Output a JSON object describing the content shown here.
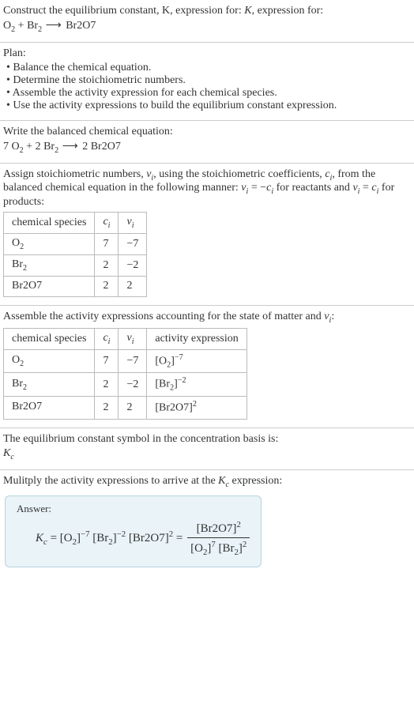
{
  "s1": {
    "prompt": "Construct the equilibrium constant, K, expression for:",
    "eq_lhs1": "O",
    "eq_lhs1_sub": "2",
    "plus1": " + ",
    "eq_lhs2": "Br",
    "eq_lhs2_sub": "2",
    "arrow": " ⟶ ",
    "eq_rhs": "Br2O7"
  },
  "plan": {
    "title": "Plan:",
    "items": [
      "Balance the chemical equation.",
      "Determine the stoichiometric numbers.",
      "Assemble the activity expression for each chemical species.",
      "Use the activity expressions to build the equilibrium constant expression."
    ]
  },
  "s3": {
    "prompt": "Write the balanced chemical equation:",
    "c1": "7 ",
    "sp1a": "O",
    "sp1b": "2",
    "plus": " + 2 ",
    "sp2a": "Br",
    "sp2b": "2",
    "arrow": " ⟶ ",
    "c3": "2 Br2O7"
  },
  "s4": {
    "prompt_a": "Assign stoichiometric numbers, ",
    "nu": "ν",
    "nu_sub": "i",
    "prompt_b": ", using the stoichiometric coefficients, ",
    "c": "c",
    "c_sub": "i",
    "prompt_c": ", from the balanced chemical equation in the following manner: ",
    "rel1a": "ν",
    "rel1b": "i",
    "rel1eq": " = −",
    "rel1c": "c",
    "rel1d": "i",
    "prompt_d": " for reactants and ",
    "rel2a": "ν",
    "rel2b": "i",
    "rel2eq": " = ",
    "rel2c": "c",
    "rel2d": "i",
    "prompt_e": " for products:",
    "headers": {
      "h1": "chemical species",
      "h2": "c",
      "h2s": "i",
      "h3": "ν",
      "h3s": "i"
    },
    "rows": [
      {
        "sp_a": "O",
        "sp_b": "2",
        "c": "7",
        "nu": "−7"
      },
      {
        "sp_a": "Br",
        "sp_b": "2",
        "c": "2",
        "nu": "−2"
      },
      {
        "sp_a": "Br2O7",
        "sp_b": "",
        "c": "2",
        "nu": "2"
      }
    ]
  },
  "s5": {
    "prompt_a": "Assemble the activity expressions accounting for the state of matter and ",
    "nu": "ν",
    "nu_sub": "i",
    "colon": ":",
    "headers": {
      "h1": "chemical species",
      "h2": "c",
      "h2s": "i",
      "h3": "ν",
      "h3s": "i",
      "h4": "activity expression"
    },
    "rows": [
      {
        "sp_a": "O",
        "sp_b": "2",
        "c": "7",
        "nu": "−7",
        "act_base": "[O",
        "act_sub": "2",
        "act_close": "]",
        "act_sup": "−7"
      },
      {
        "sp_a": "Br",
        "sp_b": "2",
        "c": "2",
        "nu": "−2",
        "act_base": "[Br",
        "act_sub": "2",
        "act_close": "]",
        "act_sup": "−2"
      },
      {
        "sp_a": "Br2O7",
        "sp_b": "",
        "c": "2",
        "nu": "2",
        "act_base": "[Br2O7]",
        "act_sub": "",
        "act_close": "",
        "act_sup": "2"
      }
    ]
  },
  "s6": {
    "prompt": "The equilibrium constant symbol in the concentration basis is:",
    "sym": "K",
    "sym_sub": "c"
  },
  "s7": {
    "prompt_a": "Mulitply the activity expressions to arrive at the ",
    "k": "K",
    "k_sub": "c",
    "prompt_b": " expression:"
  },
  "answer": {
    "label": "Answer:",
    "lhs_k": "K",
    "lhs_ks": "c",
    "eq": " = ",
    "t1a": "[O",
    "t1b": "2",
    "t1c": "]",
    "t1s": "−7",
    "sp1": " ",
    "t2a": "[Br",
    "t2b": "2",
    "t2c": "]",
    "t2s": "−2",
    "sp2": " ",
    "t3a": "[Br2O7]",
    "t3s": "2",
    "eq2": " = ",
    "num_a": "[Br2O7]",
    "num_s": "2",
    "den_1a": "[O",
    "den_1b": "2",
    "den_1c": "]",
    "den_1s": "7",
    "den_sp": " ",
    "den_2a": "[Br",
    "den_2b": "2",
    "den_2c": "]",
    "den_2s": "2"
  }
}
